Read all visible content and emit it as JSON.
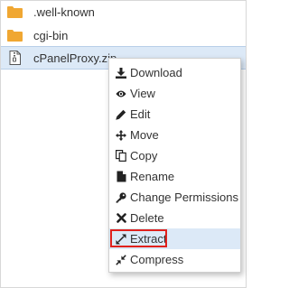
{
  "files": [
    {
      "name": ".well-known",
      "icon": "folder-icon"
    },
    {
      "name": "cgi-bin",
      "icon": "folder-icon"
    },
    {
      "name": "cPanelProxy.zip",
      "icon": "zip-file-icon"
    }
  ],
  "context_menu": {
    "items": [
      {
        "label": "Download",
        "icon": "download-icon"
      },
      {
        "label": "View",
        "icon": "eye-icon"
      },
      {
        "label": "Edit",
        "icon": "pencil-icon"
      },
      {
        "label": "Move",
        "icon": "move-arrows-icon"
      },
      {
        "label": "Copy",
        "icon": "copy-icon"
      },
      {
        "label": "Rename",
        "icon": "rename-icon"
      },
      {
        "label": "Change Permissions",
        "icon": "key-icon"
      },
      {
        "label": "Delete",
        "icon": "x-icon"
      },
      {
        "label": "Extract",
        "icon": "expand-icon"
      },
      {
        "label": "Compress",
        "icon": "compress-icon"
      }
    ],
    "highlighted_item": "Extract"
  },
  "colors": {
    "folder": "#f0a732",
    "selection": "#dce9f7",
    "highlight_border": "#e0211d"
  }
}
